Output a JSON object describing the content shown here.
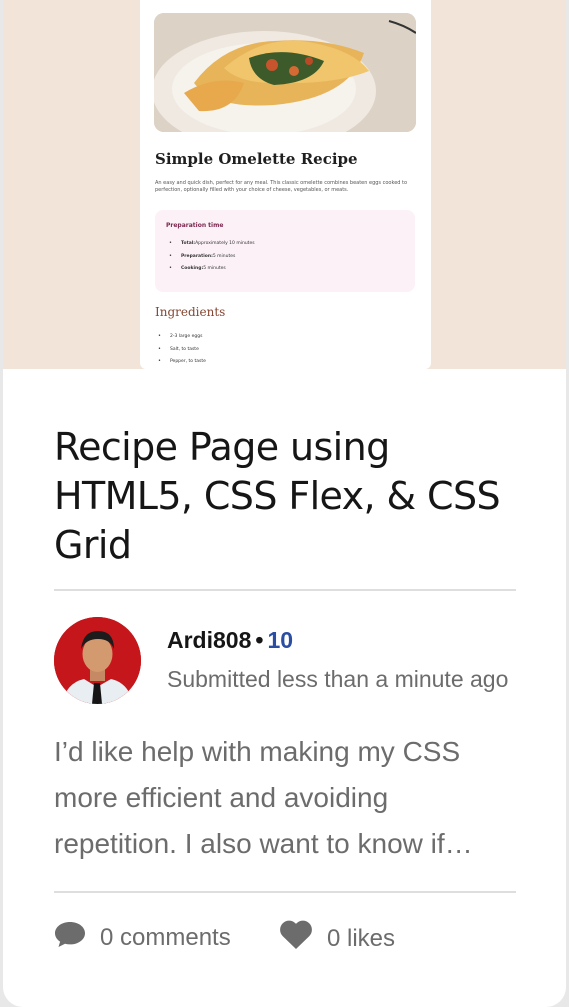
{
  "preview": {
    "recipe_title": "Simple Omelette Recipe",
    "intro": "An easy and quick dish, perfect for any meal. This classic omelette combines beaten eggs cooked to perfection, optionally filled with your choice of cheese, vegetables, or meats.",
    "prep_title": "Preparation time",
    "prep_items": [
      {
        "label": "Total:",
        "value": "Approximately 10 minutes"
      },
      {
        "label": "Preparation:",
        "value": "5 minutes"
      },
      {
        "label": "Cooking:",
        "value": "5 minutes"
      }
    ],
    "ingredients_title": "Ingredients",
    "ingredients": [
      "2-3 large eggs",
      "Salt, to taste",
      "Pepper, to taste"
    ]
  },
  "card": {
    "title": "Recipe Page using HTML5, CSS Flex, & CSS Grid",
    "author": "Ardi808",
    "separator": "•",
    "score": "10",
    "submitted": "Submitted less than a minute ago",
    "description": "I’d like help with making my CSS more efficient and avoiding repetition. I also want to know if there is a better way to structure this."
  },
  "stats": {
    "comments": "0 comments",
    "likes": "0 likes"
  },
  "colors": {
    "thumbnail_bg": "#f2e4d8",
    "score": "#2b4ea2",
    "avatar_bg": "#c4161b"
  },
  "icons": [
    "comment-icon",
    "heart-icon"
  ]
}
